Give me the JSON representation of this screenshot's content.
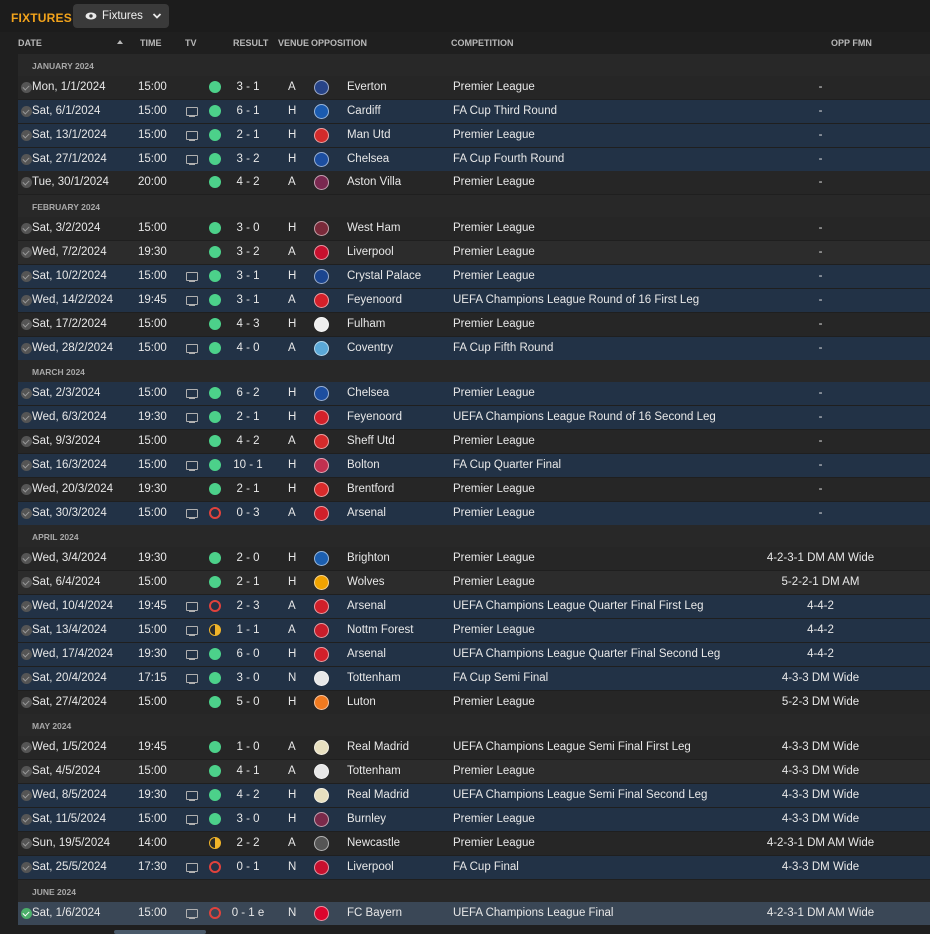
{
  "header": {
    "title": "FIXTURES",
    "view_label": "Fixtures"
  },
  "columns": {
    "date": "DATE",
    "time": "TIME",
    "tv": "TV",
    "result": "RESULT",
    "venue": "VENUE",
    "opposition": "OPPOSITION",
    "competition": "COMPETITION",
    "opp_fmn": "OPP FMN"
  },
  "colors": {
    "accent": "#f2a31b",
    "win": "#4cd18a",
    "loss": "#e0423c",
    "draw": "#f0b429",
    "tv_row": "#223246"
  },
  "groups": [
    {
      "month": "JANUARY 2024",
      "fixtures": [
        {
          "date": "Mon, 1/1/2024",
          "time": "15:00",
          "tv": false,
          "outcome": "win",
          "result": "3 - 1",
          "venue": "A",
          "opposition": "Everton",
          "crest": "#274488",
          "competition": "Premier League",
          "opp_fmn": "-"
        },
        {
          "date": "Sat, 6/1/2024",
          "time": "15:00",
          "tv": true,
          "outcome": "win",
          "result": "6 - 1",
          "venue": "H",
          "opposition": "Cardiff",
          "crest": "#1a5bb0",
          "competition": "FA Cup Third Round",
          "opp_fmn": "-"
        },
        {
          "date": "Sat, 13/1/2024",
          "time": "15:00",
          "tv": true,
          "outcome": "win",
          "result": "2 - 1",
          "venue": "H",
          "opposition": "Man Utd",
          "crest": "#d22b2b",
          "competition": "Premier League",
          "opp_fmn": "-"
        },
        {
          "date": "Sat, 27/1/2024",
          "time": "15:00",
          "tv": true,
          "outcome": "win",
          "result": "3 - 2",
          "venue": "H",
          "opposition": "Chelsea",
          "crest": "#1c4ea0",
          "competition": "FA Cup Fourth Round",
          "opp_fmn": "-"
        },
        {
          "date": "Tue, 30/1/2024",
          "time": "20:00",
          "tv": false,
          "outcome": "win",
          "result": "4 - 2",
          "venue": "A",
          "opposition": "Aston Villa",
          "crest": "#7a2850",
          "competition": "Premier League",
          "opp_fmn": "-"
        }
      ]
    },
    {
      "month": "FEBRUARY 2024",
      "fixtures": [
        {
          "date": "Sat, 3/2/2024",
          "time": "15:00",
          "tv": false,
          "outcome": "win",
          "result": "3 - 0",
          "venue": "H",
          "opposition": "West Ham",
          "crest": "#7a2a3a",
          "competition": "Premier League",
          "opp_fmn": "-"
        },
        {
          "date": "Wed, 7/2/2024",
          "time": "19:30",
          "tv": false,
          "outcome": "win",
          "result": "3 - 2",
          "venue": "A",
          "opposition": "Liverpool",
          "crest": "#c8102e",
          "competition": "Premier League",
          "opp_fmn": "-"
        },
        {
          "date": "Sat, 10/2/2024",
          "time": "15:00",
          "tv": true,
          "outcome": "win",
          "result": "3 - 1",
          "venue": "H",
          "opposition": "Crystal Palace",
          "crest": "#1b458f",
          "competition": "Premier League",
          "opp_fmn": "-"
        },
        {
          "date": "Wed, 14/2/2024",
          "time": "19:45",
          "tv": true,
          "outcome": "win",
          "result": "3 - 1",
          "venue": "A",
          "opposition": "Feyenoord",
          "crest": "#d4202a",
          "competition": "UEFA Champions League Round of 16 First Leg",
          "opp_fmn": "-"
        },
        {
          "date": "Sat, 17/2/2024",
          "time": "15:00",
          "tv": false,
          "outcome": "win",
          "result": "4 - 3",
          "venue": "H",
          "opposition": "Fulham",
          "crest": "#eeeeee",
          "competition": "Premier League",
          "opp_fmn": "-"
        },
        {
          "date": "Wed, 28/2/2024",
          "time": "15:00",
          "tv": true,
          "outcome": "win",
          "result": "4 - 0",
          "venue": "A",
          "opposition": "Coventry",
          "crest": "#5aa8d8",
          "competition": "FA Cup Fifth Round",
          "opp_fmn": "-"
        }
      ]
    },
    {
      "month": "MARCH 2024",
      "fixtures": [
        {
          "date": "Sat, 2/3/2024",
          "time": "15:00",
          "tv": true,
          "outcome": "win",
          "result": "6 - 2",
          "venue": "H",
          "opposition": "Chelsea",
          "crest": "#1c4ea0",
          "competition": "Premier League",
          "opp_fmn": "-"
        },
        {
          "date": "Wed, 6/3/2024",
          "time": "19:30",
          "tv": true,
          "outcome": "win",
          "result": "2 - 1",
          "venue": "H",
          "opposition": "Feyenoord",
          "crest": "#d4202a",
          "competition": "UEFA Champions League Round of 16 Second Leg",
          "opp_fmn": "-"
        },
        {
          "date": "Sat, 9/3/2024",
          "time": "15:00",
          "tv": false,
          "outcome": "win",
          "result": "4 - 2",
          "venue": "A",
          "opposition": "Sheff Utd",
          "crest": "#d52b2b",
          "competition": "Premier League",
          "opp_fmn": "-"
        },
        {
          "date": "Sat, 16/3/2024",
          "time": "15:00",
          "tv": true,
          "outcome": "win",
          "result": "10 - 1",
          "venue": "H",
          "opposition": "Bolton",
          "crest": "#c03050",
          "competition": "FA Cup Quarter Final",
          "opp_fmn": "-"
        },
        {
          "date": "Wed, 20/3/2024",
          "time": "19:30",
          "tv": false,
          "outcome": "win",
          "result": "2 - 1",
          "venue": "H",
          "opposition": "Brentford",
          "crest": "#d92b2b",
          "competition": "Premier League",
          "opp_fmn": "-"
        },
        {
          "date": "Sat, 30/3/2024",
          "time": "15:00",
          "tv": true,
          "outcome": "loss",
          "result": "0 - 3",
          "venue": "A",
          "opposition": "Arsenal",
          "crest": "#d1202a",
          "competition": "Premier League",
          "opp_fmn": "-"
        }
      ]
    },
    {
      "month": "APRIL 2024",
      "fixtures": [
        {
          "date": "Wed, 3/4/2024",
          "time": "19:30",
          "tv": false,
          "outcome": "win",
          "result": "2 - 0",
          "venue": "H",
          "opposition": "Brighton",
          "crest": "#1c5fb0",
          "competition": "Premier League",
          "opp_fmn": "4-2-3-1 DM AM Wide"
        },
        {
          "date": "Sat, 6/4/2024",
          "time": "15:00",
          "tv": false,
          "outcome": "win",
          "result": "2 - 1",
          "venue": "H",
          "opposition": "Wolves",
          "crest": "#f0a300",
          "competition": "Premier League",
          "opp_fmn": "5-2-2-1 DM AM"
        },
        {
          "date": "Wed, 10/4/2024",
          "time": "19:45",
          "tv": true,
          "outcome": "loss",
          "result": "2 - 3",
          "venue": "A",
          "opposition": "Arsenal",
          "crest": "#d1202a",
          "competition": "UEFA Champions League Quarter Final First Leg",
          "opp_fmn": "4-4-2"
        },
        {
          "date": "Sat, 13/4/2024",
          "time": "15:00",
          "tv": true,
          "outcome": "draw",
          "result": "1 - 1",
          "venue": "A",
          "opposition": "Nottm Forest",
          "crest": "#c81e2b",
          "competition": "Premier League",
          "opp_fmn": "4-4-2"
        },
        {
          "date": "Wed, 17/4/2024",
          "time": "19:30",
          "tv": true,
          "outcome": "win",
          "result": "6 - 0",
          "venue": "H",
          "opposition": "Arsenal",
          "crest": "#d1202a",
          "competition": "UEFA Champions League Quarter Final Second Leg",
          "opp_fmn": "4-4-2"
        },
        {
          "date": "Sat, 20/4/2024",
          "time": "17:15",
          "tv": true,
          "outcome": "win",
          "result": "3 - 0",
          "venue": "N",
          "opposition": "Tottenham",
          "crest": "#e8e8e8",
          "competition": "FA Cup Semi Final",
          "opp_fmn": "4-3-3 DM Wide"
        },
        {
          "date": "Sat, 27/4/2024",
          "time": "15:00",
          "tv": false,
          "outcome": "win",
          "result": "5 - 0",
          "venue": "H",
          "opposition": "Luton",
          "crest": "#f07a20",
          "competition": "Premier League",
          "opp_fmn": "5-2-3 DM Wide"
        }
      ]
    },
    {
      "month": "MAY 2024",
      "fixtures": [
        {
          "date": "Wed, 1/5/2024",
          "time": "19:45",
          "tv": false,
          "outcome": "win",
          "result": "1 - 0",
          "venue": "A",
          "opposition": "Real Madrid",
          "crest": "#e8e0c0",
          "competition": "UEFA Champions League Semi Final First Leg",
          "opp_fmn": "4-3-3 DM Wide"
        },
        {
          "date": "Sat, 4/5/2024",
          "time": "15:00",
          "tv": false,
          "outcome": "win",
          "result": "4 - 1",
          "venue": "A",
          "opposition": "Tottenham",
          "crest": "#e8e8e8",
          "competition": "Premier League",
          "opp_fmn": "4-3-3 DM Wide"
        },
        {
          "date": "Wed, 8/5/2024",
          "time": "19:30",
          "tv": true,
          "outcome": "win",
          "result": "4 - 2",
          "venue": "H",
          "opposition": "Real Madrid",
          "crest": "#e8e0c0",
          "competition": "UEFA Champions League Semi Final Second Leg",
          "opp_fmn": "4-3-3 DM Wide"
        },
        {
          "date": "Sat, 11/5/2024",
          "time": "15:00",
          "tv": true,
          "outcome": "win",
          "result": "3 - 0",
          "venue": "H",
          "opposition": "Burnley",
          "crest": "#7a2a4a",
          "competition": "Premier League",
          "opp_fmn": "4-3-3 DM Wide"
        },
        {
          "date": "Sun, 19/5/2024",
          "time": "14:00",
          "tv": false,
          "outcome": "draw",
          "result": "2 - 2",
          "venue": "A",
          "opposition": "Newcastle",
          "crest": "#555555",
          "competition": "Premier League",
          "opp_fmn": "4-2-3-1 DM AM Wide"
        },
        {
          "date": "Sat, 25/5/2024",
          "time": "17:30",
          "tv": true,
          "outcome": "loss",
          "result": "0 - 1",
          "venue": "N",
          "opposition": "Liverpool",
          "crest": "#c8102e",
          "competition": "FA Cup Final",
          "opp_fmn": "4-3-3 DM Wide"
        }
      ]
    },
    {
      "month": "JUNE 2024",
      "fixtures": [
        {
          "date": "Sat, 1/6/2024",
          "time": "15:00",
          "tv": true,
          "outcome": "loss",
          "result": "0 - 1 e",
          "venue": "N",
          "opposition": "FC Bayern",
          "crest": "#dc052d",
          "competition": "UEFA Champions League Final",
          "opp_fmn": "4-2-3-1 DM AM Wide"
        }
      ]
    }
  ]
}
